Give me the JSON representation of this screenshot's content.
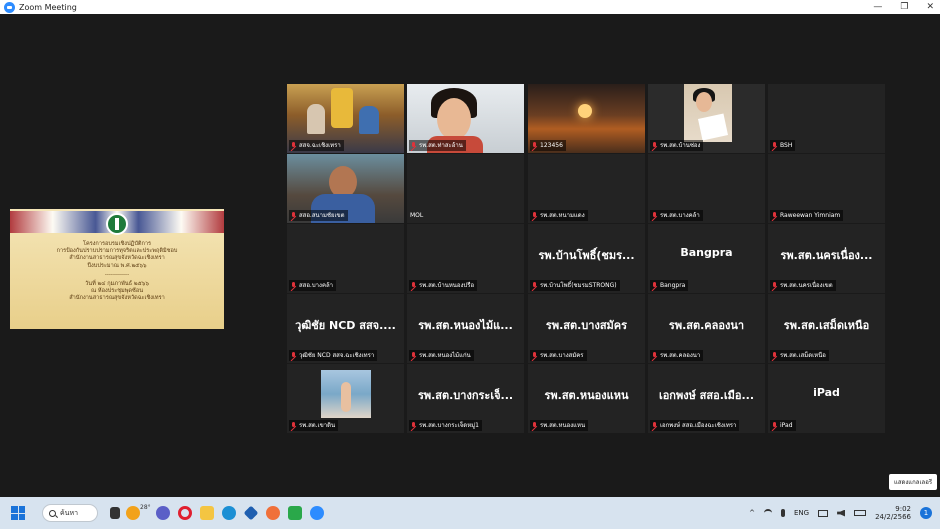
{
  "window": {
    "title": "Zoom Meeting",
    "controls": [
      "—",
      "❐",
      "✕"
    ]
  },
  "shared_screen": {
    "lines": [
      "โครงการอบรมเชิงปฏิบัติการ",
      "การป้องกันปราบปรามการทุจริตและประพฤติมิชอบ",
      "สำนักงานสาธารณสุขจังหวัดฉะเชิงเทรา",
      "ปีงบประมาณ พ.ศ.๒๕๖๖",
      "------------",
      "วันที่ ๒๔ กุมภาพันธ์ ๒๕๖๖",
      "ณ ห้องประชุมพุดซ้อน",
      "สำนักงานสาธารณสุขจังหวัดฉะเชิงเทรา"
    ]
  },
  "participants": [
    {
      "label": "สสจ.ฉะเชิงเทรา",
      "big": "",
      "video": "img1",
      "active": true
    },
    {
      "label": "รพ.สต.ท่าสะอ้าน",
      "big": "",
      "video": "img2"
    },
    {
      "label": "123456",
      "big": "",
      "video": "img3"
    },
    {
      "label": "รพ.สต.บ้านซ่อง",
      "big": "",
      "video": "img4"
    },
    {
      "label": "BSH",
      "big": "",
      "video": ""
    },
    {
      "label": "สสอ.สนามชัยเขต",
      "big": "",
      "video": "img5"
    },
    {
      "label": "MOL",
      "big": "",
      "video": "",
      "plain": true
    },
    {
      "label": "รพ.สต.หนามแดง",
      "big": "",
      "video": ""
    },
    {
      "label": "รพ.สต.บางคล้า",
      "big": "",
      "video": ""
    },
    {
      "label": "Raweewan Yimniam",
      "big": "",
      "video": ""
    },
    {
      "label": "สสอ.บางคล้า",
      "big": "",
      "video": ""
    },
    {
      "label": "รพ.สต.บ้านหนองปรือ",
      "big": "",
      "video": ""
    },
    {
      "label": "รพ.บ้านโพธิ์(ชมรมSTRONG)",
      "big": "รพ.บ้านโพธิ์(ชมร...",
      "video": ""
    },
    {
      "label": "Bangpra",
      "big": "Bangpra",
      "video": ""
    },
    {
      "label": "รพ.สต.นครเนื่องเขต",
      "big": "รพ.สต.นครเนื่อง...",
      "video": ""
    },
    {
      "label": "วุฒิชัย NCD สสจ.ฉะเชิงเทรา",
      "big": "วุฒิชัย NCD สสจ....",
      "video": ""
    },
    {
      "label": "รพ.สต.หนองไม้แก่น",
      "big": "รพ.สต.หนองไม้แ...",
      "video": ""
    },
    {
      "label": "รพ.สต.บางสมัคร",
      "big": "รพ.สต.บางสมัคร",
      "video": ""
    },
    {
      "label": "รพ.สต.คลองนา",
      "big": "รพ.สต.คลองนา",
      "video": ""
    },
    {
      "label": "รพ.สต.เสม็ดเหนือ",
      "big": "รพ.สต.เสม็ดเหนือ",
      "video": ""
    },
    {
      "label": "รพ.สต.เขาดิน",
      "big": "",
      "video": "img6"
    },
    {
      "label": "รพ.สต.บางกระเจ็ดหมู่1",
      "big": "รพ.สต.บางกระเจ็...",
      "video": ""
    },
    {
      "label": "รพ.สต.หนองแหน",
      "big": "รพ.สต.หนองแหน",
      "video": ""
    },
    {
      "label": "เอกพงษ์ สสอ.เมืองฉะเชิงเทรา",
      "big": "เอกพงษ์ สสอ.เมือ...",
      "video": ""
    },
    {
      "label": "iPad",
      "big": "iPad",
      "video": ""
    }
  ],
  "hide_button": "แสดงแกลเลอรี",
  "taskbar": {
    "search": "ค้นหา",
    "weather": "28°",
    "tray": {
      "caret": "^",
      "lang": "ENG"
    },
    "time": "9:02",
    "date": "24/2/2566",
    "notifications": "1"
  }
}
